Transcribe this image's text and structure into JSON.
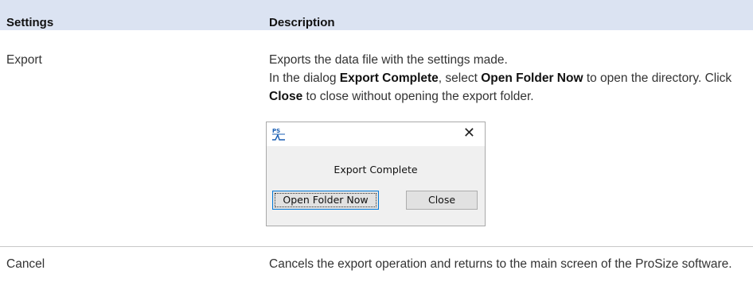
{
  "table": {
    "headers": {
      "settings": "Settings",
      "description": "Description"
    },
    "rows": [
      {
        "setting": "Export",
        "desc_line1": "Exports the data file with the settings made.",
        "desc_line2_a": "In the dialog ",
        "desc_line2_b": "Export Complete",
        "desc_line2_c": ", select ",
        "desc_line2_d": "Open Folder Now",
        "desc_line2_e": " to open the directory. Click ",
        "desc_line2_f": "Close",
        "desc_line2_g": " to close without opening the export folder."
      },
      {
        "setting": "Cancel",
        "desc": "Cancels the export operation and returns to the main screen of the ProSize software."
      }
    ]
  },
  "dialog": {
    "logo_text": "PS",
    "close_glyph": "✕",
    "message": "Export Complete",
    "open_button": "Open Folder Now",
    "close_button": "Close"
  },
  "colors": {
    "header_bg": "#dbe3f2",
    "logo_blue": "#1a5fb4"
  }
}
